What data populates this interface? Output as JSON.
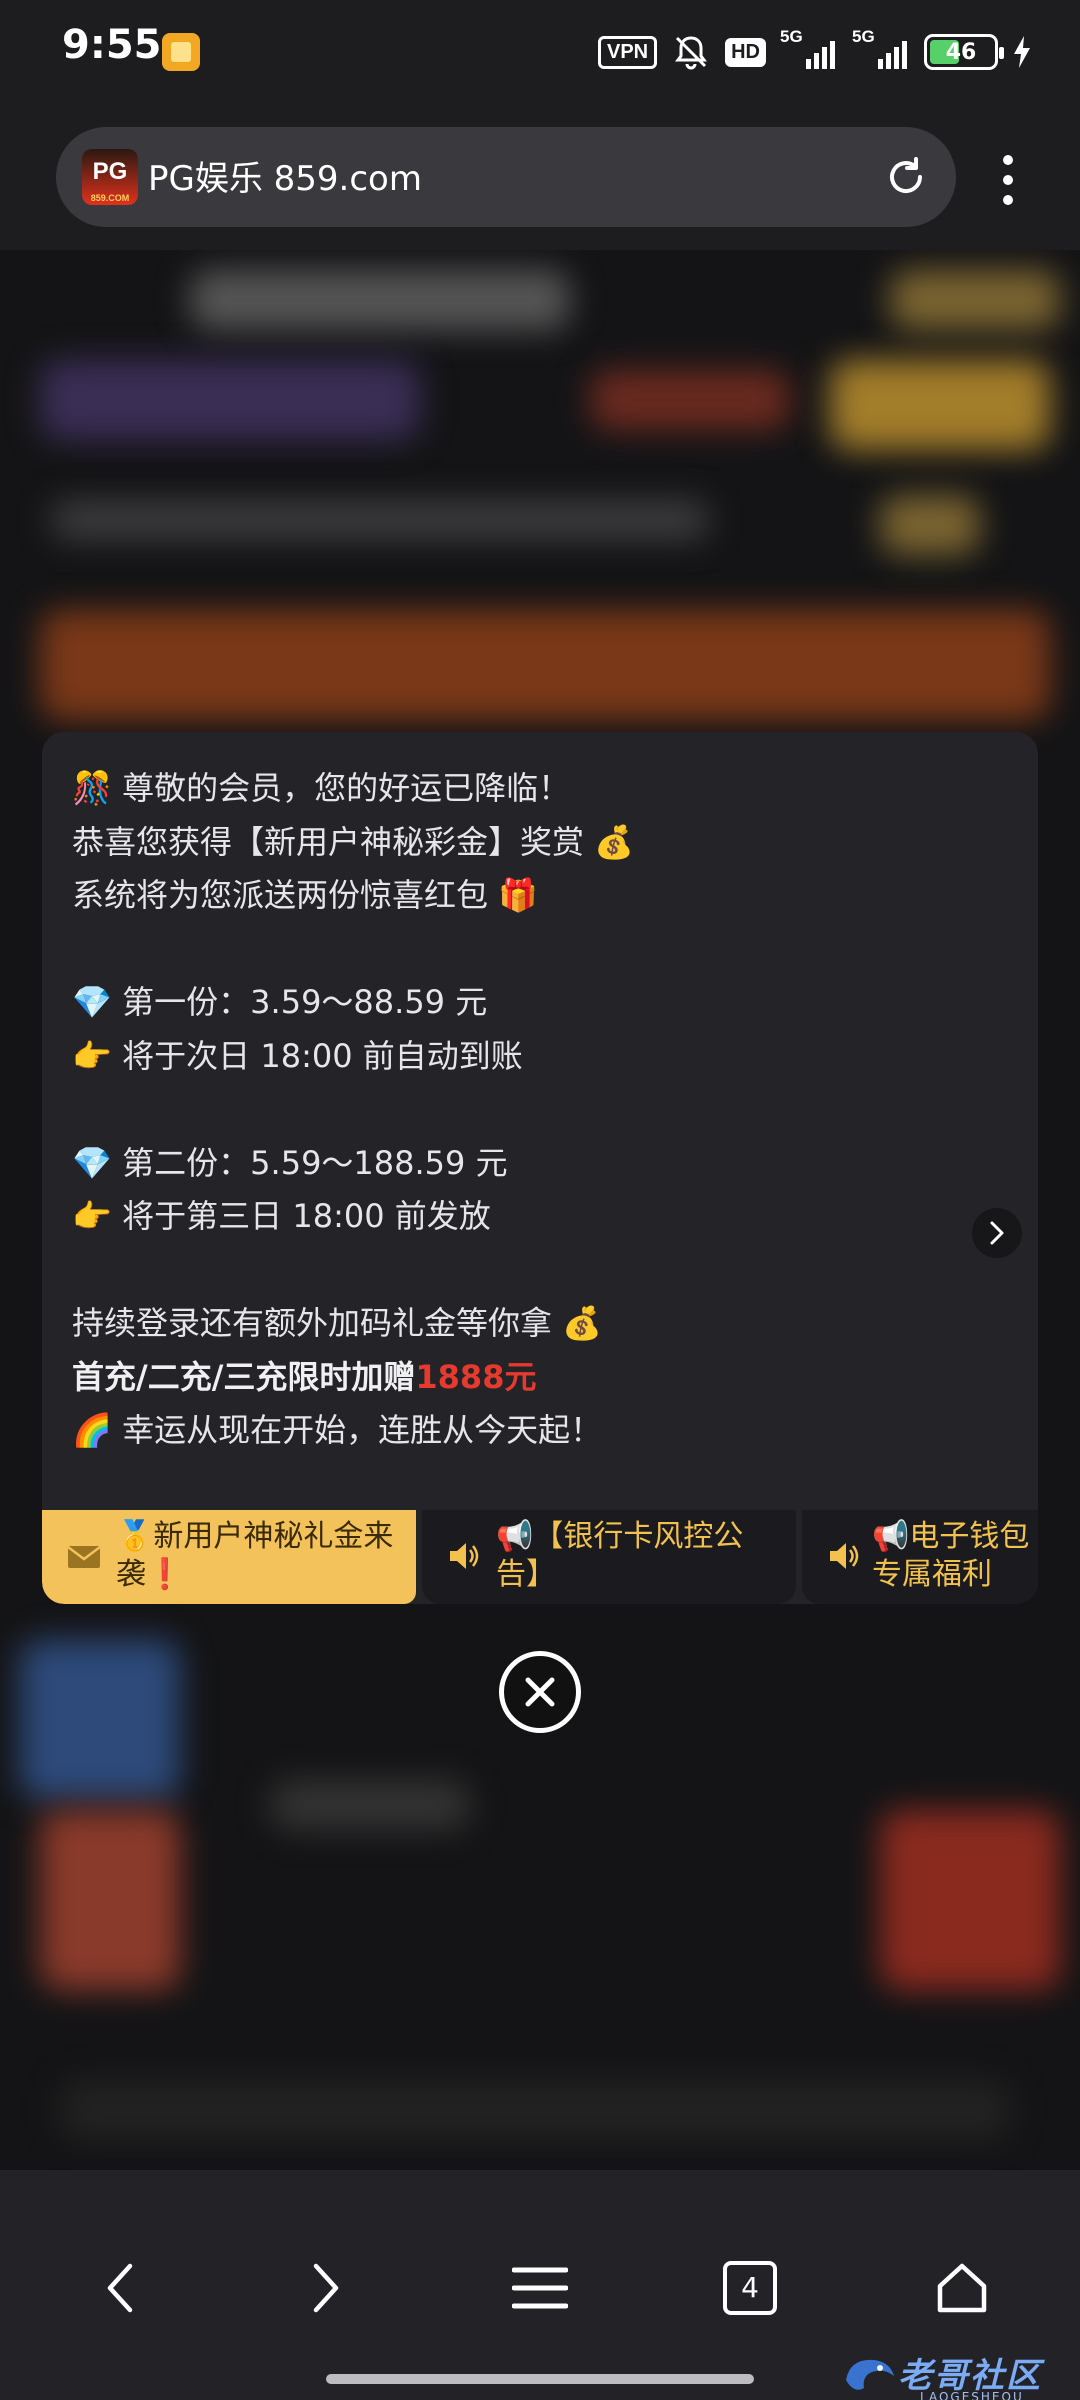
{
  "status_bar": {
    "time": "9:55",
    "vpn": "VPN",
    "hd": "HD",
    "signal1": "5G",
    "signal2": "5G",
    "battery": "46"
  },
  "browser": {
    "site_icon_text": "PG",
    "site_icon_sub": "859.COM",
    "url": "PG娱乐 859.com"
  },
  "popup": {
    "lines": [
      {
        "emoji": "🎊",
        "text": "尊敬的会员，您的好运已降临！"
      },
      {
        "text": "恭喜您获得【新用户神秘彩金】奖赏",
        "emoji_after": "💰"
      },
      {
        "text": "系统将为您派送两份惊喜红包",
        "emoji_after": "🎁"
      },
      {
        "emoji": "💎",
        "text": "第一份：3.59～88.59 元"
      },
      {
        "emoji": "👉",
        "text": "将于次日 18:00 前自动到账"
      },
      {
        "emoji": "💎",
        "text": "第二份：5.59～188.59 元"
      },
      {
        "emoji": "👉",
        "text": "将于第三日 18:00 前发放"
      },
      {
        "text": "持续登录还有额外加码礼金等你拿",
        "emoji_after": "💰"
      },
      {
        "bold": "首充/二充/三充限时加赠",
        "red": "1888元"
      },
      {
        "emoji": "🌈",
        "text": "幸运从现在开始，连胜从今天起！"
      }
    ],
    "tabs": [
      {
        "label": "🥇新用户神秘礼金来袭❗",
        "icon": "envelope-icon",
        "active": true
      },
      {
        "label": "📢【银行卡风控公告】",
        "icon": "speaker-icon",
        "active": false
      },
      {
        "label": "📢电子钱包专属福利",
        "icon": "speaker-icon",
        "active": false
      }
    ]
  },
  "bottom_nav": {
    "tab_count": "4"
  },
  "watermark": {
    "text": "老哥社区",
    "sub": "LAOGESHEQU"
  },
  "colors": {
    "accent": "#f3c25b",
    "highlight": "#e63a2e",
    "popup_bg": "#232328"
  }
}
